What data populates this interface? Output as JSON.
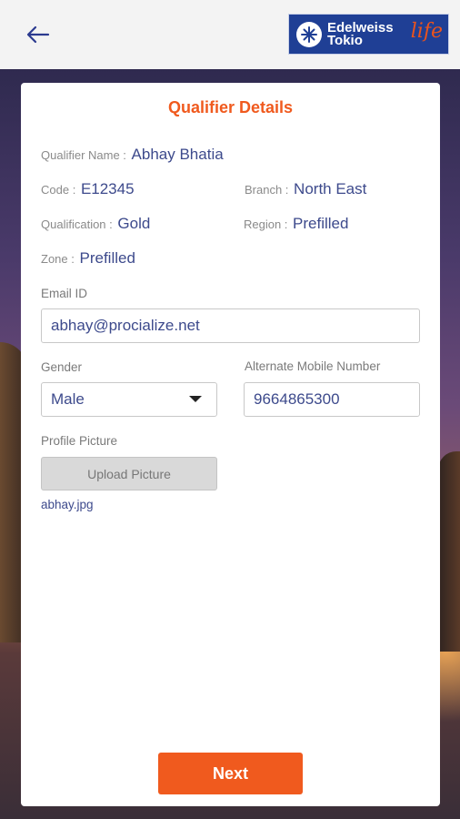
{
  "header": {
    "back_icon": "arrow-left-icon",
    "logo": {
      "line1": "Edelweiss",
      "line2": "Tokio",
      "script": "life"
    }
  },
  "card": {
    "title": "Qualifier Details",
    "qualifier_name": {
      "label": "Qualifier Name :",
      "value": "Abhay Bhatia"
    },
    "code": {
      "label": "Code :",
      "value": "E12345"
    },
    "branch": {
      "label": "Branch :",
      "value": "North East"
    },
    "qualification": {
      "label": "Qualification :",
      "value": "Gold"
    },
    "region": {
      "label": "Region :",
      "value": "Prefilled"
    },
    "zone": {
      "label": "Zone :",
      "value": "Prefilled"
    },
    "email": {
      "label": "Email ID",
      "value": "abhay@procialize.net"
    },
    "gender": {
      "label": "Gender",
      "value": "Male"
    },
    "alt_mobile": {
      "label": "Alternate Mobile Number",
      "value": "9664865300"
    },
    "profile_picture": {
      "label": "Profile Picture",
      "button": "Upload Picture",
      "filename": "abhay.jpg"
    },
    "next_button": "Next"
  },
  "colors": {
    "accent": "#f05a1e",
    "value_text": "#3d4a8c",
    "brand_blue": "#1f3f95"
  }
}
